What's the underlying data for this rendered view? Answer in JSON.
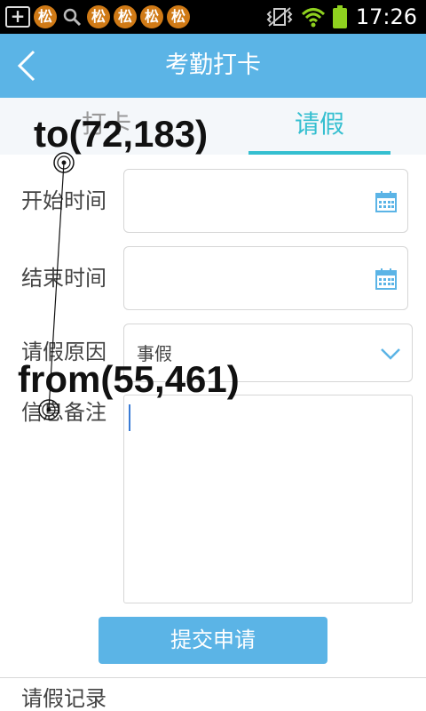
{
  "status_bar": {
    "time": "17:26",
    "app_glyph": "松",
    "icons": [
      "add-icon",
      "app-icon",
      "search-icon",
      "vibrate-icon",
      "wifi-icon",
      "battery-icon"
    ]
  },
  "header": {
    "title": "考勤打卡"
  },
  "tabs": [
    {
      "label": "打卡",
      "active": false
    },
    {
      "label": "请假",
      "active": true
    }
  ],
  "form": {
    "start_time": {
      "label": "开始时间",
      "value": ""
    },
    "end_time": {
      "label": "结束时间",
      "value": ""
    },
    "reason": {
      "label": "请假原因",
      "value": "事假"
    },
    "notes": {
      "label": "信息备注",
      "value": ""
    },
    "submit_label": "提交申请"
  },
  "records": {
    "label": "请假记录"
  },
  "annotation": {
    "to_label": "to(72,183)",
    "from_label": "from(55,461)"
  },
  "colors": {
    "primary": "#5bb4e6",
    "tab_active": "#35bfd0",
    "status_bar": "#000000"
  }
}
